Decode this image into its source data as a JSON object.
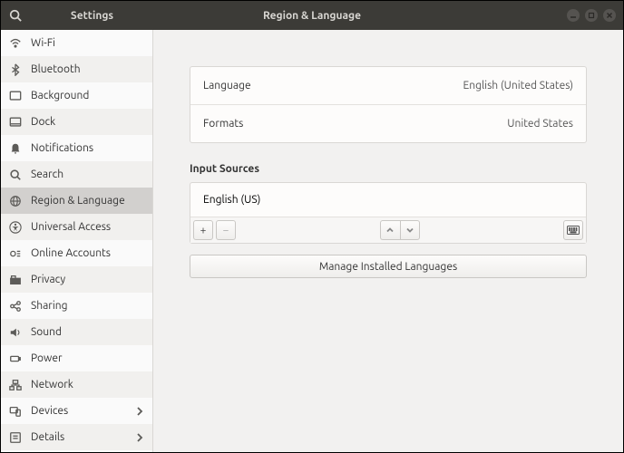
{
  "titlebar": {
    "search_icon": "search",
    "sidebar_title": "Settings",
    "window_title": "Region & Language"
  },
  "sidebar": {
    "items": [
      {
        "label": "Wi-Fi"
      },
      {
        "label": "Bluetooth"
      },
      {
        "label": "Background"
      },
      {
        "label": "Dock"
      },
      {
        "label": "Notifications"
      },
      {
        "label": "Search"
      },
      {
        "label": "Region & Language"
      },
      {
        "label": "Universal Access"
      },
      {
        "label": "Online Accounts"
      },
      {
        "label": "Privacy"
      },
      {
        "label": "Sharing"
      },
      {
        "label": "Sound"
      },
      {
        "label": "Power"
      },
      {
        "label": "Network"
      },
      {
        "label": "Devices"
      },
      {
        "label": "Details"
      }
    ]
  },
  "content": {
    "language": {
      "label": "Language",
      "value": "English (United States)"
    },
    "formats": {
      "label": "Formats",
      "value": "United States"
    },
    "input_sources_heading": "Input Sources",
    "input_sources": [
      "English (US)"
    ],
    "buttons": {
      "add": "+",
      "remove": "−",
      "up": "⌃",
      "down": "⌄"
    },
    "manage_button": "Manage Installed Languages"
  }
}
